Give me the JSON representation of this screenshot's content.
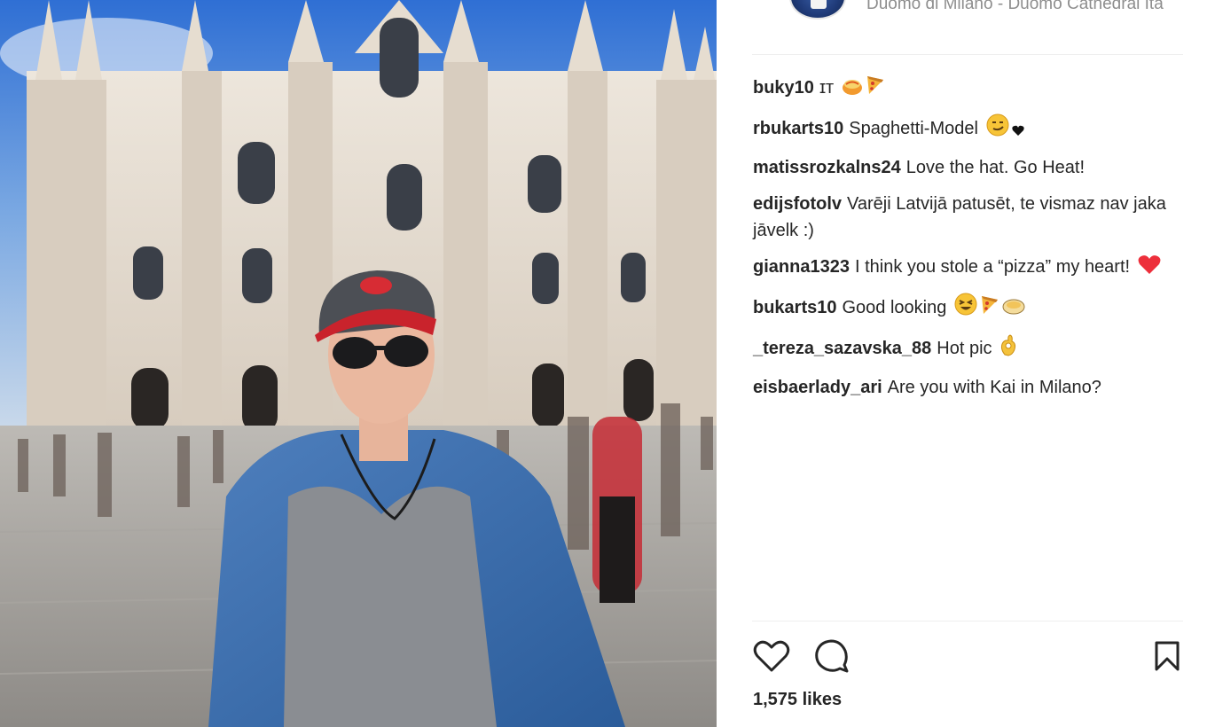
{
  "header": {
    "location": "Duomo di Milano - Duomo Cathedral Ita"
  },
  "comments": [
    {
      "user": "buky10",
      "text": "ɪᴛ",
      "emojis": [
        "bowl-icon",
        "pizza-icon"
      ]
    },
    {
      "user": "rbukarts10",
      "text": "Spaghetti-Model",
      "emojis": [
        "smirk-face-icon",
        "heart-black-icon"
      ]
    },
    {
      "user": "matissrozkalns24",
      "text": "Love the hat. Go Heat!",
      "emojis": []
    },
    {
      "user": "edijsfotolv",
      "text": "Varēji Latvijā patusēt, te vismaz nav jaka jāvelk :)",
      "emojis": []
    },
    {
      "user": "gianna1323",
      "text": "I think you stole a “pizza” my heart!",
      "emojis": [
        "heart-red-icon"
      ]
    },
    {
      "user": "bukarts10",
      "text": "Good looking",
      "emojis": [
        "laughing-face-icon",
        "pizza-icon",
        "bowl-icon"
      ]
    },
    {
      "user": "_tereza_sazavska_88",
      "text": "Hot pic",
      "emojis": [
        "ok-hand-icon"
      ]
    },
    {
      "user": "eisbaerlady_ari",
      "text": "Are you with Kai in Milano?",
      "emojis": []
    }
  ],
  "actions": {
    "like_icon": "heart-outline-icon",
    "comment_icon": "comment-bubble-icon",
    "save_icon": "bookmark-icon"
  },
  "likes": "1,575 likes",
  "colors": {
    "text": "#262626",
    "muted": "#8e8e8e",
    "divider": "#efefef",
    "heart_red": "#ed2f3b",
    "emoji_yellow": "#f7c437"
  }
}
